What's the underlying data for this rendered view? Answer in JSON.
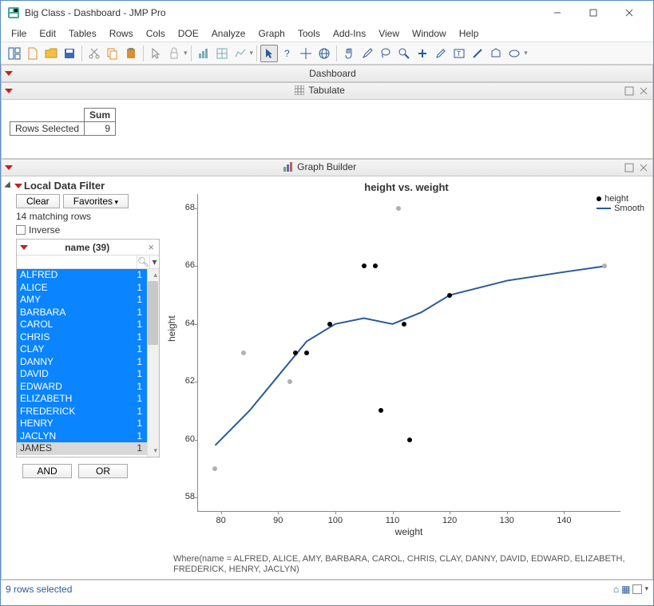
{
  "window": {
    "title": "Big Class - Dashboard - JMP Pro"
  },
  "menu": [
    "File",
    "Edit",
    "Tables",
    "Rows",
    "Cols",
    "DOE",
    "Analyze",
    "Graph",
    "Tools",
    "Add-Ins",
    "View",
    "Window",
    "Help"
  ],
  "sections": {
    "dashboard": "Dashboard",
    "tabulate": "Tabulate",
    "graphbuilder": "Graph Builder"
  },
  "tabulate": {
    "col_header": "Sum",
    "row_label": "Rows Selected",
    "value": "9"
  },
  "filter": {
    "title": "Local Data Filter",
    "clear": "Clear",
    "favorites": "Favorites",
    "matching": "14 matching rows",
    "inverse": "Inverse",
    "name_header": "name (39)",
    "search_placeholder": "",
    "and": "AND",
    "or": "OR",
    "items": [
      {
        "name": "ALFRED",
        "count": "1",
        "sel": true
      },
      {
        "name": "ALICE",
        "count": "1",
        "sel": true
      },
      {
        "name": "AMY",
        "count": "1",
        "sel": true
      },
      {
        "name": "BARBARA",
        "count": "1",
        "sel": true
      },
      {
        "name": "CAROL",
        "count": "1",
        "sel": true
      },
      {
        "name": "CHRIS",
        "count": "1",
        "sel": true
      },
      {
        "name": "CLAY",
        "count": "1",
        "sel": true
      },
      {
        "name": "DANNY",
        "count": "1",
        "sel": true
      },
      {
        "name": "DAVID",
        "count": "1",
        "sel": true
      },
      {
        "name": "EDWARD",
        "count": "1",
        "sel": true
      },
      {
        "name": "ELIZABETH",
        "count": "1",
        "sel": true
      },
      {
        "name": "FREDERICK",
        "count": "1",
        "sel": true
      },
      {
        "name": "HENRY",
        "count": "1",
        "sel": true
      },
      {
        "name": "JACLYN",
        "count": "1",
        "sel": true
      },
      {
        "name": "JAMES",
        "count": "1",
        "sel": false
      }
    ]
  },
  "chart_data": {
    "type": "scatter",
    "title": "height vs. weight",
    "xlabel": "weight",
    "ylabel": "height",
    "xlim": [
      76,
      150
    ],
    "ylim": [
      57.5,
      68.5
    ],
    "xticks": [
      80,
      90,
      100,
      110,
      120,
      130,
      140
    ],
    "yticks": [
      58,
      60,
      62,
      64,
      66,
      68
    ],
    "legend": [
      {
        "label": "height",
        "type": "point"
      },
      {
        "label": "Smooth",
        "type": "line"
      }
    ],
    "series": [
      {
        "name": "height",
        "type": "scatter",
        "points": [
          {
            "x": 79,
            "y": 59,
            "sel": false
          },
          {
            "x": 84,
            "y": 63,
            "sel": false
          },
          {
            "x": 92,
            "y": 62,
            "sel": false
          },
          {
            "x": 93,
            "y": 63,
            "sel": true
          },
          {
            "x": 95,
            "y": 63,
            "sel": true
          },
          {
            "x": 99,
            "y": 64,
            "sel": true
          },
          {
            "x": 105,
            "y": 66,
            "sel": true
          },
          {
            "x": 107,
            "y": 66,
            "sel": true
          },
          {
            "x": 108,
            "y": 61,
            "sel": true
          },
          {
            "x": 111,
            "y": 68,
            "sel": false
          },
          {
            "x": 112,
            "y": 64,
            "sel": true
          },
          {
            "x": 113,
            "y": 60,
            "sel": true
          },
          {
            "x": 120,
            "y": 65,
            "sel": true
          },
          {
            "x": 147,
            "y": 66,
            "sel": false
          }
        ]
      },
      {
        "name": "Smooth",
        "type": "line",
        "points": [
          {
            "x": 79,
            "y": 59.8
          },
          {
            "x": 85,
            "y": 61.0
          },
          {
            "x": 90,
            "y": 62.2
          },
          {
            "x": 95,
            "y": 63.4
          },
          {
            "x": 100,
            "y": 64.0
          },
          {
            "x": 105,
            "y": 64.2
          },
          {
            "x": 110,
            "y": 64.0
          },
          {
            "x": 115,
            "y": 64.4
          },
          {
            "x": 120,
            "y": 65.0
          },
          {
            "x": 130,
            "y": 65.5
          },
          {
            "x": 140,
            "y": 65.8
          },
          {
            "x": 147,
            "y": 66.0
          }
        ]
      }
    ],
    "where_text": "Where(name = ALFRED, ALICE, AMY, BARBARA, CAROL, CHRIS, CLAY, DANNY, DAVID, EDWARD, ELIZABETH, FREDERICK, HENRY, JACLYN)"
  },
  "status": "9 rows selected"
}
